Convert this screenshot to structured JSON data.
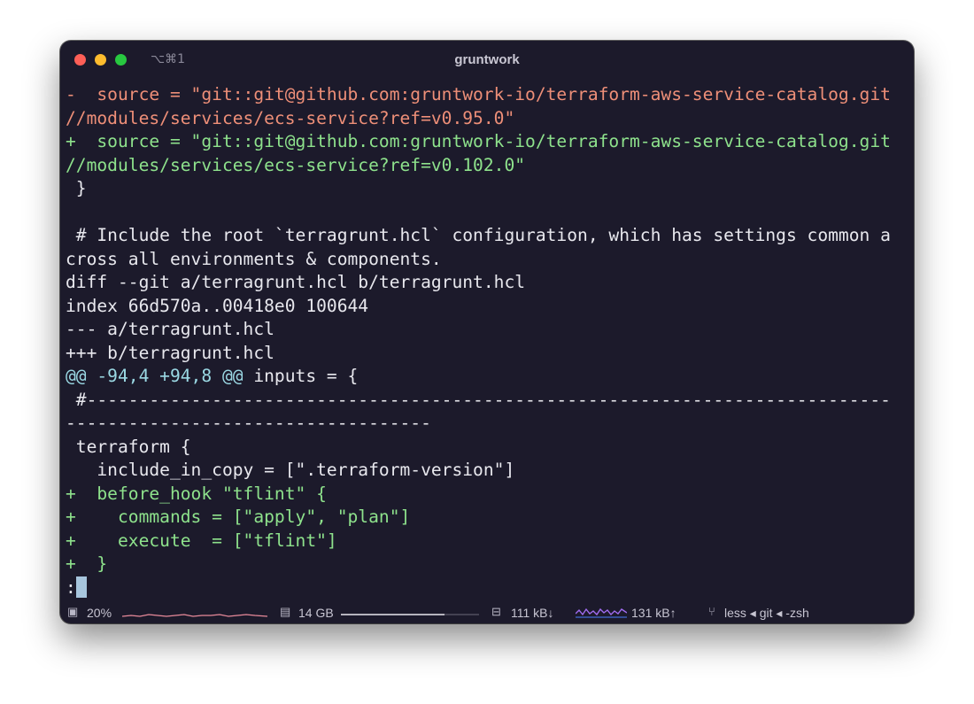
{
  "window": {
    "title": "gruntwork",
    "shortcut": "⌥⌘1"
  },
  "terminal": {
    "lines": [
      {
        "type": "del",
        "text": "-  source = \"git::git@github.com:gruntwork-io/terraform-aws-service-catalog.git"
      },
      {
        "type": "del",
        "text": "//modules/services/ecs-service?ref=v0.95.0\""
      },
      {
        "type": "add",
        "text": "+  source = \"git::git@github.com:gruntwork-io/terraform-aws-service-catalog.git"
      },
      {
        "type": "add",
        "text": "//modules/services/ecs-service?ref=v0.102.0\""
      },
      {
        "type": "plain",
        "text": " }"
      },
      {
        "type": "plain",
        "text": ""
      },
      {
        "type": "plain",
        "text": " # Include the root `terragrunt.hcl` configuration, which has settings common a"
      },
      {
        "type": "plain",
        "text": "cross all environments & components."
      },
      {
        "type": "plain",
        "text": "diff --git a/terragrunt.hcl b/terragrunt.hcl"
      },
      {
        "type": "plain",
        "text": "index 66d570a..00418e0 100644"
      },
      {
        "type": "plain",
        "text": "--- a/terragrunt.hcl"
      },
      {
        "type": "plain",
        "text": "+++ b/terragrunt.hcl"
      },
      {
        "type": "hunk",
        "text": "@@ -94,4 +94,8 @@",
        "rest": " inputs = {"
      },
      {
        "type": "plain",
        "text": " #-----------------------------------------------------------------------------"
      },
      {
        "type": "plain",
        "text": "-----------------------------------"
      },
      {
        "type": "plain",
        "text": " terraform {"
      },
      {
        "type": "plain",
        "text": "   include_in_copy = [\".terraform-version\"]"
      },
      {
        "type": "add",
        "text": "+  before_hook \"tflint\" {"
      },
      {
        "type": "add",
        "text": "+    commands = [\"apply\", \"plan\"]"
      },
      {
        "type": "add",
        "text": "+    execute  = [\"tflint\"]"
      },
      {
        "type": "add",
        "text": "+  }"
      }
    ],
    "prompt": ":"
  },
  "statusbar": {
    "cpu": {
      "icon": "cpu-icon",
      "value": "20%",
      "color": "#e88a9a"
    },
    "memory": {
      "icon": "memory-icon",
      "value": "14 GB",
      "usage_fraction": 0.75
    },
    "download": {
      "icon": "network-icon",
      "value": "111 kB↓"
    },
    "upload": {
      "value": "131 kB↑",
      "color": "#a06cf0"
    },
    "process": {
      "icon": "git-branch-icon",
      "text": "less ◂ git ◂ -zsh"
    }
  },
  "colors": {
    "background": "#1c1a2b",
    "removed": "#ee8f78",
    "added": "#8ee28c",
    "hunk": "#9bd9e4",
    "text": "#e8e8ee"
  }
}
